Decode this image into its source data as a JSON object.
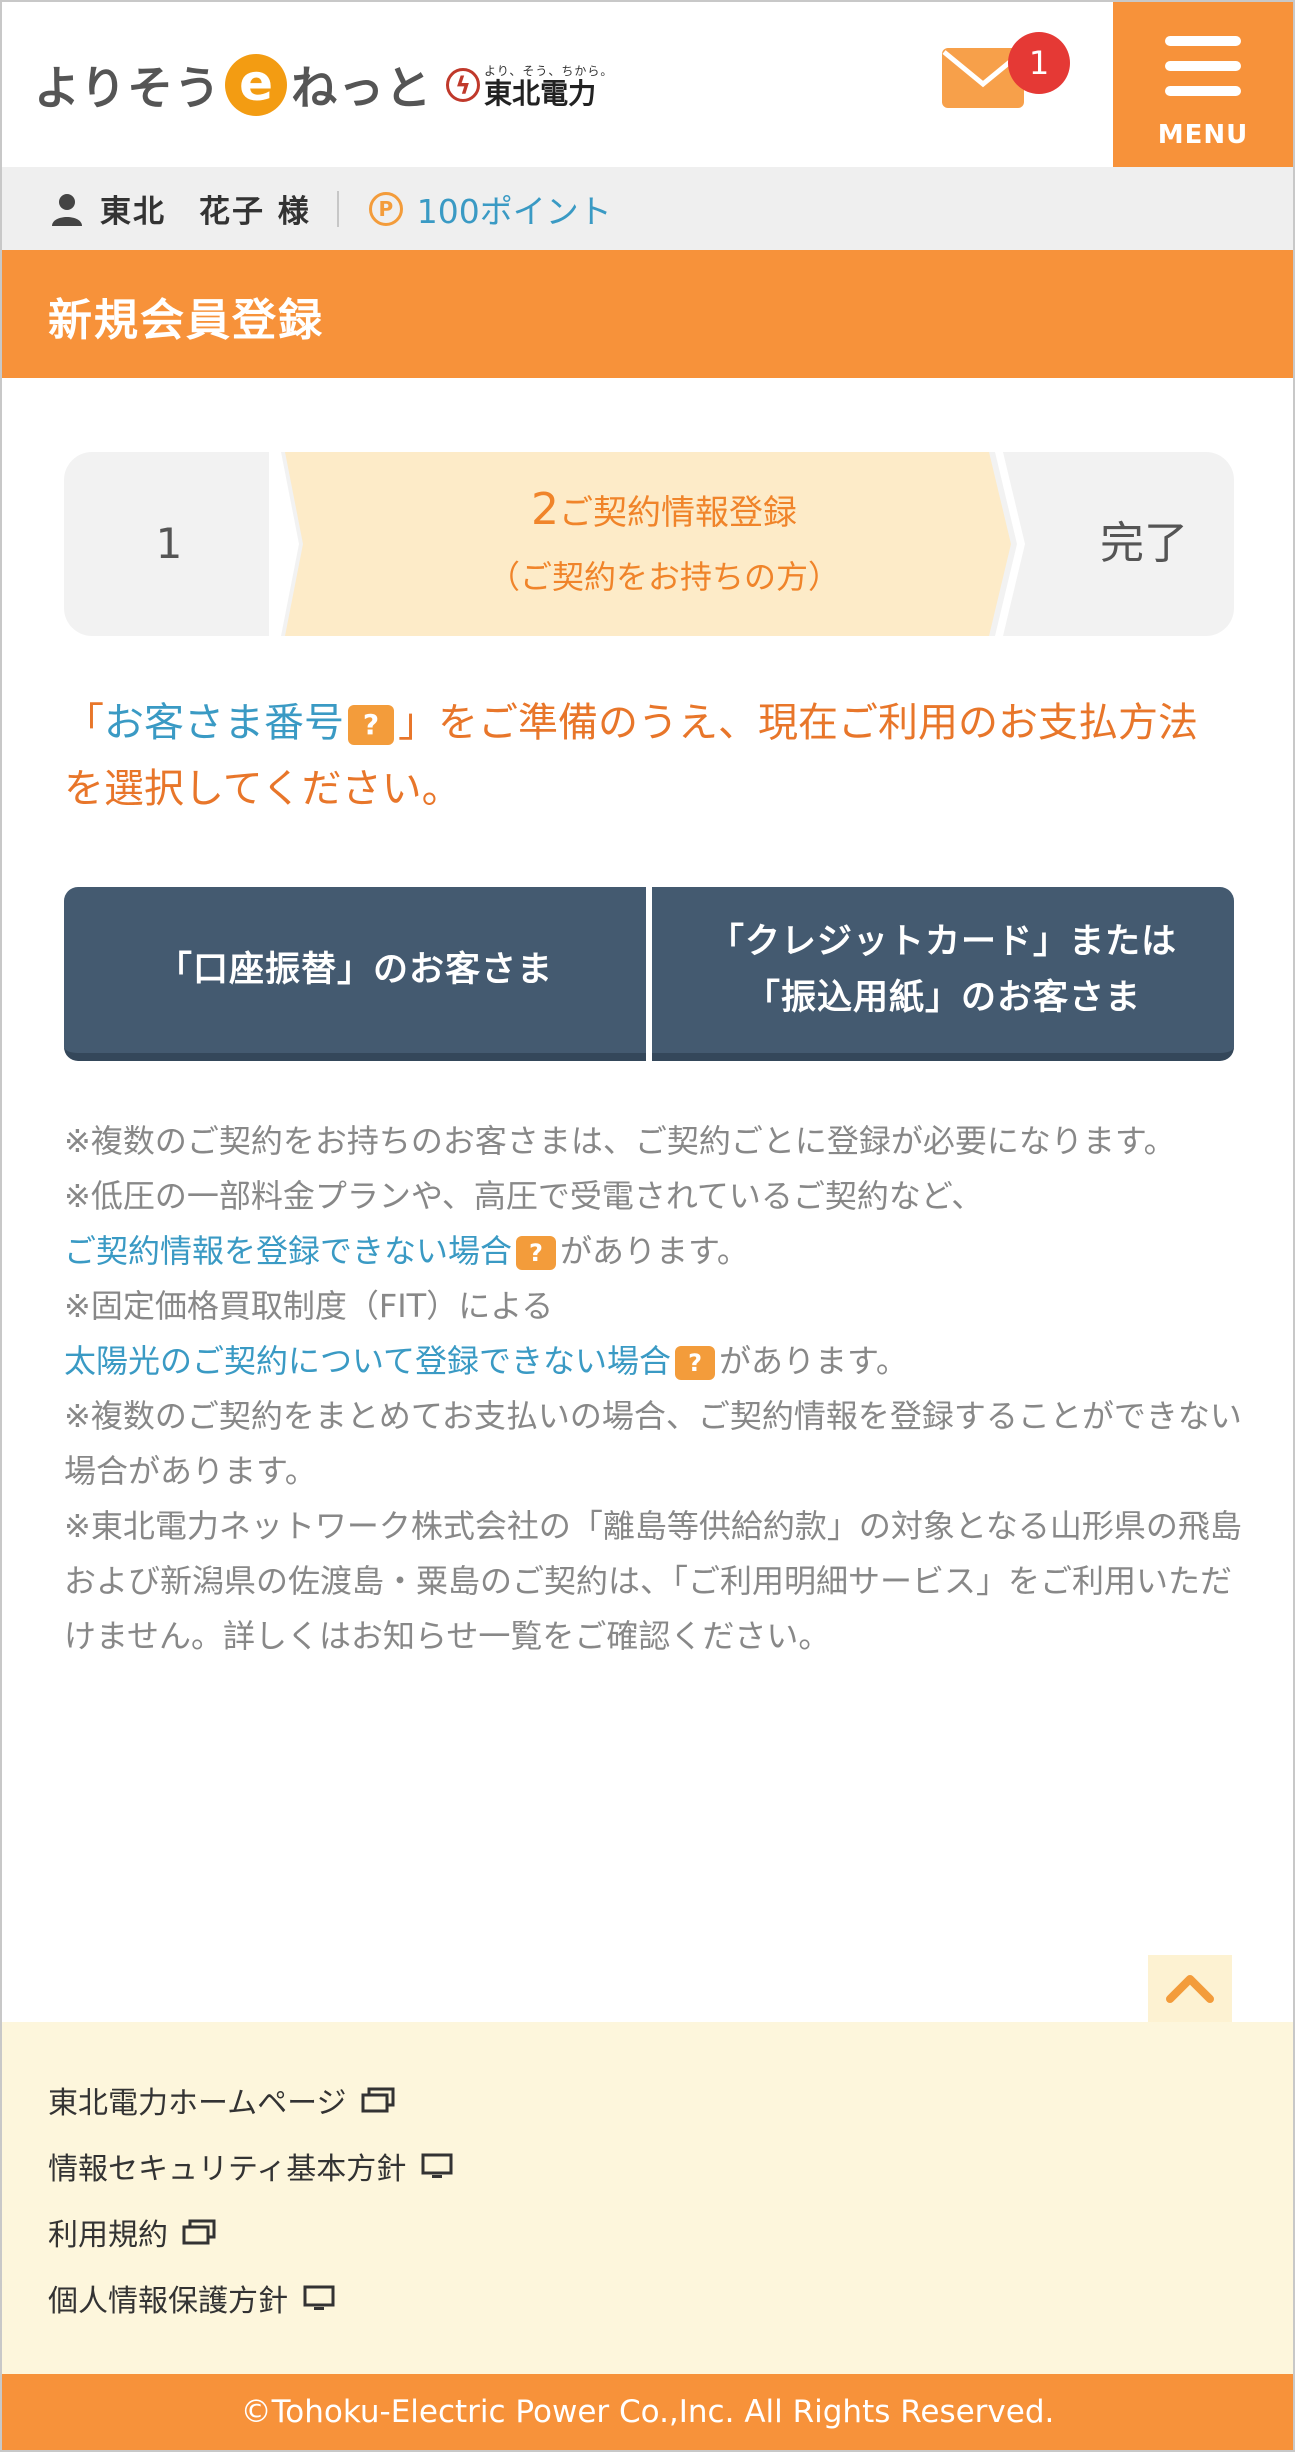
{
  "header": {
    "logo_prefix": "よりそう",
    "logo_e": "e",
    "logo_suffix": "ねっと",
    "brand_slogan": "より、そう、ちから。",
    "brand_name": "東北電力",
    "mail_badge": "1",
    "menu_label": "MENU"
  },
  "user": {
    "name": "東北　花子 様",
    "point_symbol": "P",
    "points": "100ポイント"
  },
  "page_title": "新規会員登録",
  "steps": {
    "step1": "1",
    "step2_num": "2",
    "step2_label": "ご契約情報登録",
    "step2_sub": "（ご契約をお持ちの方）",
    "step3": "完了"
  },
  "instruction": {
    "open_bracket": "「",
    "link": "お客さま番号",
    "q": "?",
    "rest": "」をご準備のうえ、現在ご利用のお支払方法を選択してください。"
  },
  "buttons": {
    "bank_transfer": "「口座振替」のお客さま",
    "card_line1": "「クレジットカード」または",
    "card_line2": "「振込用紙」のお客さま"
  },
  "notes": {
    "n1": "※複数のご契約をお持ちのお客さまは、ご契約ごとに登録が必要になります。",
    "n2": "※低圧の一部料金プランや、高圧で受電されているご契約など、",
    "n2_link": "ご契約情報を登録できない場合",
    "n2_tail": "があります。",
    "n3": "※固定価格買取制度（FIT）による",
    "n3_link": "太陽光のご契約について登録できない場合",
    "n3_tail": "があります。",
    "n4": "※複数のご契約をまとめてお支払いの場合、ご契約情報を登録することができない場合があります。",
    "n5": "※東北電力ネットワーク株式会社の「離島等供給約款」の対象となる山形県の飛島および新潟県の佐渡島・粟島のご契約は、「ご利用明細サービス」をご利用いただけません。詳しくはお知らせ一覧をご確認ください。"
  },
  "footer": {
    "links": [
      "東北電力ホームページ",
      "情報セキュリティ基本方針",
      "利用規約",
      "個人情報保護方針"
    ],
    "copyright": "©Tohoku-Electric Power Co.,Inc. All Rights Reserved."
  },
  "colors": {
    "orange": "#f7923a",
    "navy_button": "#445a70",
    "link_blue": "#3a9ac4",
    "footer_bg": "#fdf6dc"
  }
}
